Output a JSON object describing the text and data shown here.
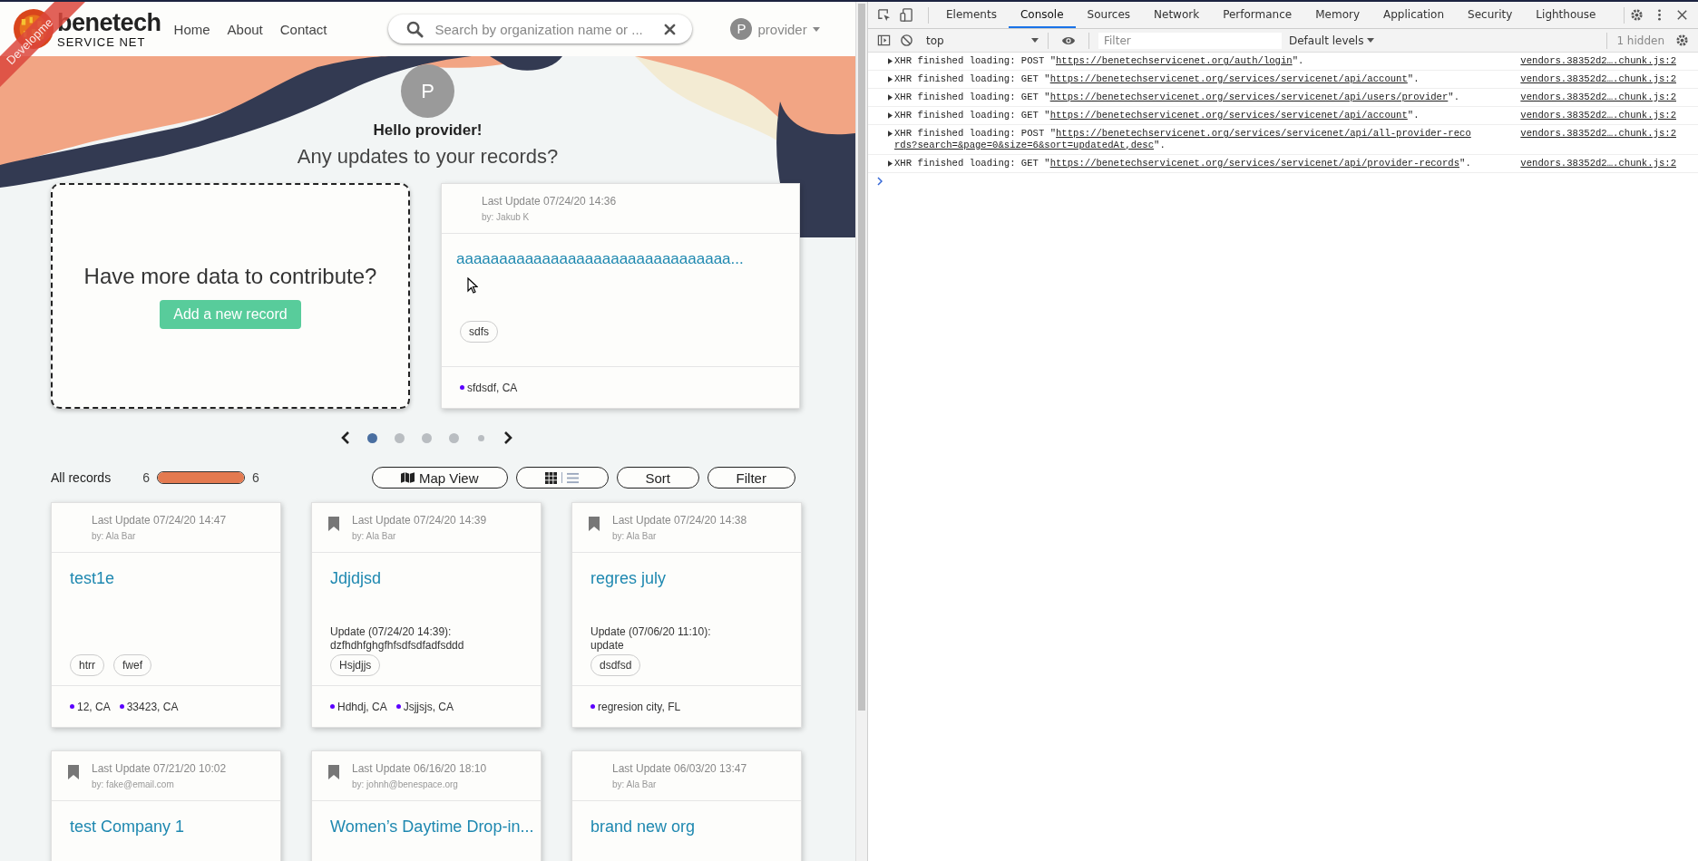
{
  "header": {
    "ribbon": "Developme",
    "brand": "benetech",
    "brand_sub": "SERVICE NET",
    "nav": [
      "Home",
      "About",
      "Contact"
    ],
    "search": {
      "placeholder": "Search by organization name or ..."
    },
    "user": {
      "initial": "P",
      "name": "provider"
    }
  },
  "hero": {
    "initial": "P",
    "greeting": "Hello provider!",
    "question": "Any updates to your records?"
  },
  "contribute": {
    "text": "Have more data to contribute?",
    "button": "Add a new record"
  },
  "featured": {
    "bookmarked": false,
    "updated": "Last Update 07/24/20 14:36",
    "by": "by: Jakub K",
    "title": "aaaaaaaaaaaaaaaaaaaaaaaaaaaaaaaa...",
    "tags": [
      "sdfs"
    ],
    "locations": [
      "sfdsdf, CA"
    ]
  },
  "carousel": [
    {
      "selected": true
    },
    {
      "selected": false
    },
    {
      "selected": false
    },
    {
      "selected": false
    },
    {
      "selected": false
    }
  ],
  "records_bar": {
    "label": "All records",
    "count_from": "6",
    "level": 1,
    "count_to": "6",
    "map_button": "Map View",
    "view_options": [
      {
        "kind": "grid",
        "selected": true
      },
      {
        "kind": "list",
        "selected": false
      }
    ],
    "sort_button": "Sort",
    "filter_button": "Filter"
  },
  "records": [
    {
      "bookmarked": false,
      "updated": "Last Update 07/24/20 14:47",
      "by": "by: Ala Bar",
      "title": "test1e",
      "tags": [
        "htrr",
        "fwef"
      ],
      "locations": [
        "12, CA",
        "33423, CA"
      ]
    },
    {
      "bookmarked": true,
      "updated": "Last Update 07/24/20 14:39",
      "by": "by: Ala Bar",
      "title": "Jdjdjsd",
      "update": "Update (07/24/20 14:39): dzfhdhfghgfhfsdfsdfadfsddd",
      "tags": [
        "Hsjdjjs"
      ],
      "locations": [
        "Hdhdj, CA",
        "Jsjjsjs, CA"
      ]
    },
    {
      "bookmarked": true,
      "updated": "Last Update 07/24/20 14:38",
      "by": "by: Ala Bar",
      "title": "regres july",
      "update": "Update (07/06/20 11:10): update",
      "tags": [
        "dsdfsd"
      ],
      "locations": [
        "regresion city, FL"
      ]
    },
    {
      "bookmarked": true,
      "updated": "Last Update 07/21/20 10:02",
      "by": "by: fake@email.com",
      "title": "test Company 1"
    },
    {
      "bookmarked": true,
      "updated": "Last Update 06/16/20 18:10",
      "by": "by: johnh@benespace.org",
      "title": "Women’s Daytime Drop-in..."
    },
    {
      "bookmarked": false,
      "updated": "Last Update 06/03/20 13:47",
      "by": "by: Ala Bar",
      "title": "brand new org"
    }
  ],
  "devtools": {
    "tabs": [
      {
        "label": "Elements",
        "selected": false
      },
      {
        "label": "Console",
        "selected": true
      },
      {
        "label": "Sources",
        "selected": false
      },
      {
        "label": "Network",
        "selected": false
      },
      {
        "label": "Performance",
        "selected": false
      },
      {
        "label": "Memory",
        "selected": false
      },
      {
        "label": "Application",
        "selected": false
      },
      {
        "label": "Security",
        "selected": false
      },
      {
        "label": "Lighthouse",
        "selected": false
      }
    ],
    "context": "top",
    "filter_placeholder": "Filter",
    "levels": "Default levels",
    "hidden": "1 hidden",
    "messages": [
      {
        "text": "XHR finished loading: POST \"",
        "url": "https://benetechservicenet.org/auth/login",
        "end": "\".",
        "source": "vendors.38352d2….chunk.js:2"
      },
      {
        "text": "XHR finished loading: GET \"",
        "url": "https://benetechservicenet.org/services/servicenet/api/account",
        "end": "\".",
        "source": "vendors.38352d2….chunk.js:2"
      },
      {
        "text": "XHR finished loading: GET \"",
        "url": "https://benetechservicenet.org/services/servicenet/api/users/provider",
        "end": "\".",
        "source": "vendors.38352d2….chunk.js:2"
      },
      {
        "text": "XHR finished loading: GET \"",
        "url": "https://benetechservicenet.org/services/servicenet/api/account",
        "end": "\".",
        "source": "vendors.38352d2….chunk.js:2"
      },
      {
        "text": "XHR finished loading: POST \"",
        "url": "https://benetechservicenet.org/services/servicenet/api/all-provider-records?search=&page=0&size=6&sort=updatedAt,desc",
        "end": "\".",
        "source": "vendors.38352d2….chunk.js:2"
      },
      {
        "text": "XHR finished loading: GET \"",
        "url": "https://benetechservicenet.org/services/servicenet/api/provider-records",
        "end": "\".",
        "source": "vendors.38352d2….chunk.js:2"
      }
    ]
  }
}
